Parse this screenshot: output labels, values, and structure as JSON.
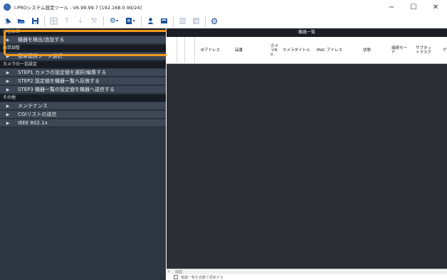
{
  "window": {
    "title": "i-PROシステム設定ツール - V6.99.99.7 [192.168.0.99/24]",
    "minimize_glyph": "−",
    "maximize_glyph": "☐",
    "close_glyph": "✕"
  },
  "toolbar": {
    "icons": [
      "pin-icon",
      "open-folder-icon",
      "save-icon",
      "grid-icon",
      "upload-icon",
      "download-icon",
      "tools-icon",
      "settings-dropdown-icon",
      "document-dropdown-icon",
      "user-icon",
      "card-icon",
      "table-icon",
      "export-icon",
      "gear-icon"
    ]
  },
  "sidebar": {
    "sections": [
      {
        "title": "はじめに",
        "items": [
          "機器を検出/追加する"
        ]
      },
      {
        "title": "画質調整",
        "items": [
          "簡単画質シーン選択"
        ]
      },
      {
        "title": "カメラの一括設定",
        "items": [
          "STEP1 カメラの設定値を選択/編集する",
          "STEP2 設定値を機器一覧へ反映する",
          "STEP3 機器一覧の設定値を機器へ送信する"
        ]
      },
      {
        "title": "その他",
        "items": [
          "メンテナンス",
          "CGIリストの送信",
          "IEEE 802.1x"
        ]
      }
    ]
  },
  "device_list": {
    "title": "機器一覧",
    "columns": [
      "IPアドレス",
      "品番",
      "カメラNo.",
      "カメラタイトル",
      "MAC アドレス",
      "状態",
      "接続モード",
      "サブネットマスク",
      "ゲ"
    ],
    "rows": []
  },
  "footer": {
    "text": "機器一覧を自動で更新する"
  },
  "colors": {
    "sidebar_bg": "#2e3642",
    "section_header_bg": "#171c24",
    "menu_item_bg": "#3c4654",
    "panel_bg": "#2b2f35",
    "highlight": "#f39a1e"
  }
}
